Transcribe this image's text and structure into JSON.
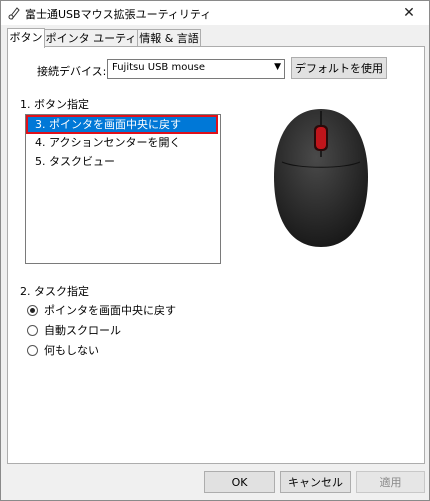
{
  "window": {
    "title": "富士通USBマウス拡張ユーティリティ",
    "close_glyph": "✕"
  },
  "tabs": [
    {
      "label": "ボタン",
      "active": true
    },
    {
      "label": "ポインタ ユーティリティ",
      "active": false
    },
    {
      "label": "情報 & 言語",
      "active": false
    }
  ],
  "device": {
    "label": "接続デバイス:",
    "value": "Fujitsu USB mouse",
    "default_button": "デフォルトを使用"
  },
  "button_section": {
    "title": "1. ボタン指定",
    "items": [
      {
        "label": "3. ポインタを画面中央に戻す",
        "selected": true
      },
      {
        "label": "4. アクションセンターを開く",
        "selected": false
      },
      {
        "label": "5. タスクビュー",
        "selected": false
      }
    ]
  },
  "task_section": {
    "title": "2. タスク指定",
    "options": [
      {
        "label": "ポインタを画面中央に戻す",
        "checked": true
      },
      {
        "label": "自動スクロール",
        "checked": false
      },
      {
        "label": "何もしない",
        "checked": false
      }
    ]
  },
  "footer": {
    "ok": "OK",
    "cancel": "キャンセル",
    "apply": "適用"
  },
  "colors": {
    "selection": "#0078d7",
    "highlight_border": "#e0101a",
    "mouse_body": "#2a2a2a",
    "mouse_wheel": "#c0151b"
  }
}
